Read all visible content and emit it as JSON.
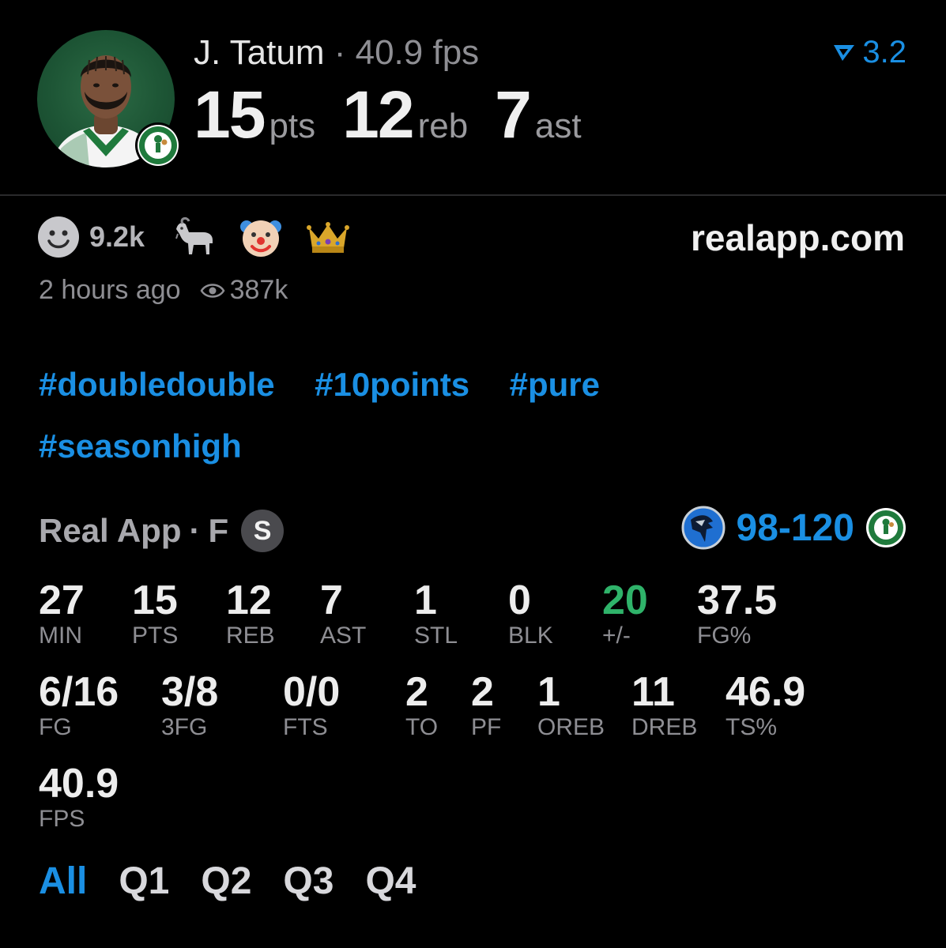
{
  "header": {
    "player_name": "J. Tatum",
    "separator": "·",
    "fps_label": "40.9 fps",
    "rating": "3.2",
    "big_stats": [
      {
        "value": "15",
        "unit": "pts"
      },
      {
        "value": "12",
        "unit": "reb"
      },
      {
        "value": "7",
        "unit": "ast"
      }
    ]
  },
  "reactions": {
    "count": "9.2k",
    "icons": [
      "smiley-icon",
      "goat-icon",
      "clown-icon",
      "crown-icon"
    ],
    "site": "realapp.com"
  },
  "meta": {
    "time_ago": "2 hours ago",
    "views": "387k"
  },
  "tags": [
    "#doubledouble",
    "#10points",
    "#pure",
    "#seasonhigh"
  ],
  "game": {
    "source": "Real App",
    "separator": "·",
    "status": "F",
    "badge": "S",
    "score": "98-120"
  },
  "stats_row1": [
    {
      "value": "27",
      "label": "MIN"
    },
    {
      "value": "15",
      "label": "PTS"
    },
    {
      "value": "12",
      "label": "REB"
    },
    {
      "value": "7",
      "label": "AST"
    },
    {
      "value": "1",
      "label": "STL"
    },
    {
      "value": "0",
      "label": "BLK"
    },
    {
      "value": "20",
      "label": "+/-"
    },
    {
      "value": "37.5",
      "label": "FG%"
    }
  ],
  "stats_row2": [
    {
      "value": "6/16",
      "label": "FG"
    },
    {
      "value": "3/8",
      "label": "3FG"
    },
    {
      "value": "0/0",
      "label": "FTS"
    },
    {
      "value": "2",
      "label": "TO"
    },
    {
      "value": "2",
      "label": "PF"
    },
    {
      "value": "1",
      "label": "OREB"
    },
    {
      "value": "11",
      "label": "DREB"
    },
    {
      "value": "46.9",
      "label": "TS%"
    }
  ],
  "stats_row3": [
    {
      "value": "40.9",
      "label": "FPS"
    }
  ],
  "quarters": {
    "tabs": [
      "All",
      "Q1",
      "Q2",
      "Q3",
      "Q4"
    ],
    "selected": "All"
  },
  "colors": {
    "accent": "#1a8fe3",
    "positive": "#2fb36a",
    "background": "#000000",
    "celtics_green": "#1d5535",
    "mavs_blue": "#1f6fd1"
  }
}
